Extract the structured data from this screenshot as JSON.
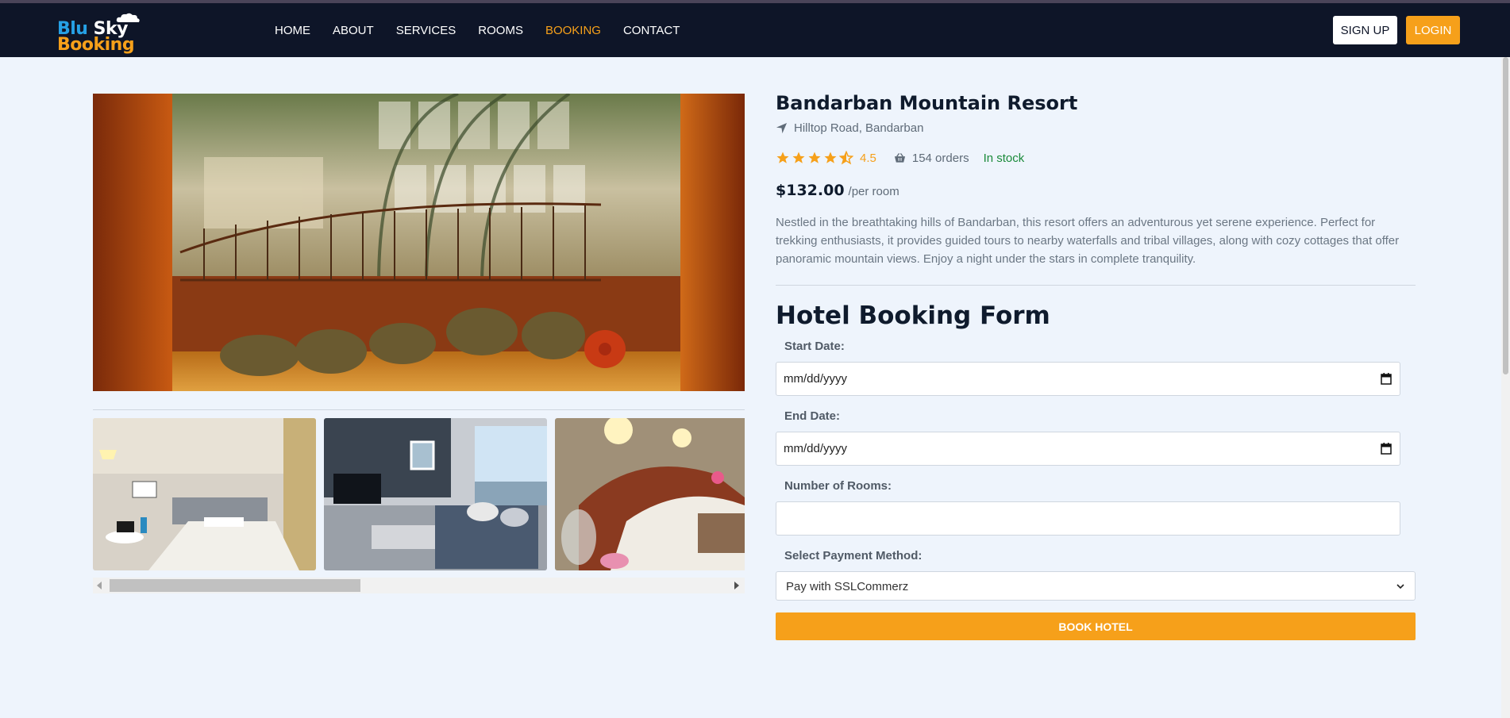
{
  "brand": {
    "line1_a": "Blu",
    "line1_b": "Sky",
    "line2": "Booking"
  },
  "nav": {
    "items": [
      {
        "label": "HOME",
        "active": false
      },
      {
        "label": "ABOUT",
        "active": false
      },
      {
        "label": "SERVICES",
        "active": false
      },
      {
        "label": "ROOMS",
        "active": false
      },
      {
        "label": "BOOKING",
        "active": true
      },
      {
        "label": "CONTACT",
        "active": false
      }
    ],
    "signup_label": "SIGN UP",
    "login_label": "LOGIN"
  },
  "hotel": {
    "name": "Bandarban Mountain Resort",
    "location": "Hilltop Road, Bandarban",
    "rating": "4.5",
    "rating_value": 4.5,
    "orders": "154 orders",
    "stock": "In stock",
    "price": "$132.00",
    "price_unit": "/per room",
    "description": "Nestled in the breathtaking hills of Bandarban, this resort offers an adventurous yet serene experience. Perfect for trekking enthusiasts, it provides guided tours to nearby waterfalls and tribal villages, along with cozy cottages that offer panoramic mountain views. Enjoy a night under the stars in complete tranquility."
  },
  "form": {
    "title": "Hotel Booking Form",
    "start_label": "Start Date:",
    "start_placeholder": "mm/dd/yyyy",
    "end_label": "End Date:",
    "end_placeholder": "mm/dd/yyyy",
    "rooms_label": "Number of Rooms:",
    "rooms_value": "",
    "payment_label": "Select Payment Method:",
    "payment_value": "Pay with SSLCommerz",
    "submit_label": "BOOK HOTEL"
  },
  "colors": {
    "accent": "#f6a01a",
    "navbar": "#0e1528",
    "background": "#eef4fc",
    "stock": "#1a8a3a"
  }
}
